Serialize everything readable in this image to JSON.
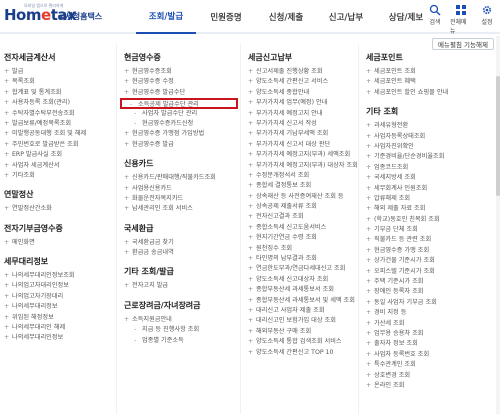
{
  "header": {
    "logo_mark_a": "Hom",
    "logo_mark_x": "e",
    "logo_mark_b": "tax",
    "logo_korean": "국세청홈택스",
    "logo_tiny": "모바일 앱으로 편리하게",
    "tabs": [
      {
        "label": "조회/발급",
        "active": true
      },
      {
        "label": "민원증명",
        "active": false
      },
      {
        "label": "신청/제출",
        "active": false
      },
      {
        "label": "신고/납부",
        "active": false
      },
      {
        "label": "상담/제보",
        "active": false
      }
    ],
    "util": [
      {
        "label": "검색",
        "icon": "search-icon"
      },
      {
        "label": "전체메뉴",
        "icon": "menu-icon"
      },
      {
        "label": "설정",
        "icon": "gear-icon"
      }
    ],
    "menu_button": "메뉴펼침 기능해제"
  },
  "columns": {
    "c1": {
      "sections": [
        {
          "title": "전자세금계산서",
          "items": [
            "발급",
            "목록조회",
            "합계표 및 통계조회",
            "사용자등록 조회(관리)",
            "수탁자별수탁부전송조회",
            "발급보류/예정목록조회",
            "미발행공동대행 조회 및 해제",
            "주민번호로 발급받은 조회",
            "ERP 발급사실 조회",
            "사업자 세금계산서",
            "기타조회"
          ]
        },
        {
          "title": "연말정산",
          "items": [
            "연말정산간소화"
          ]
        },
        {
          "title": "전자기부금영수증",
          "items": [
            "메인화면"
          ]
        },
        {
          "title": "세무대리정보",
          "items": [
            "나의세무대리인정보조회",
            "나의업고자대리인정보",
            "나의업고자기장대리",
            "나의세무대리정보",
            "위임된 해정정보",
            "나의세무대리인 해제",
            "나의세무대리인정보"
          ]
        }
      ]
    },
    "c2": {
      "sections": [
        {
          "title": "현금영수증",
          "items": [
            {
              "t": "현금영수증조회",
              "indent": false
            },
            {
              "t": "현금영수증 수정",
              "indent": false
            },
            {
              "t": "현금영수증 발급수단",
              "indent": false
            },
            {
              "t": "소득공제 발급수단 관리",
              "indent": true,
              "hl": true
            },
            {
              "t": "사업자 발급수단 관리",
              "indent": true
            },
            {
              "t": "현금영수증카드신청",
              "indent": true
            },
            {
              "t": "현금영수증 가맹점 가입방법",
              "indent": false
            },
            {
              "t": "현금영수증 발급",
              "indent": false
            }
          ]
        },
        {
          "title": "신용카드",
          "items": [
            {
              "t": "신용카드/판매대행/직불카드조회",
              "indent": false
            },
            {
              "t": "사업용신용카드",
              "indent": false
            },
            {
              "t": "화물운전자복지카드",
              "indent": false
            },
            {
              "t": "납세관리인 조회 서비스",
              "indent": false
            }
          ]
        },
        {
          "title": "국세환급",
          "items": [
            {
              "t": "국세환급금 찾기",
              "indent": false
            },
            {
              "t": "환급금 송금내역",
              "indent": false
            }
          ]
        },
        {
          "title": "기타 조회/발급",
          "items": [
            {
              "t": "전자고지 발급",
              "indent": false
            }
          ]
        },
        {
          "title": "근로장려금/자녀장려금",
          "items": [
            {
              "t": "소득지원금안내",
              "indent": false
            },
            {
              "t": "지급 등 진행사항 조회",
              "indent": true
            },
            {
              "t": "업종별 기준소득",
              "indent": true
            }
          ]
        }
      ]
    },
    "c3": {
      "sections": [
        {
          "title": "세금신고납부",
          "items": [
            "신고서제출 진행상황 조회",
            "양도소득세 간편신고 서비스",
            "양도소득세 종합안내",
            "부가가치세 업무(예정) 안내",
            "부가가치세 예정고지 안내",
            "부가가치세 신고서 작성",
            "부가가치세 기납부세액 조회",
            "부가가치세 신고서 대상 판단",
            "부가가치세 예정고지(부과) 세액조회",
            "부가가치세 예정고지(부과) 대상자 조회",
            "수정분개정석서 조회",
            "종합세 결정통보 조회",
            "상속재산 등 사전증여재산 조회 등",
            "상속공제 제출서류 조회",
            "전자신고결과 조회",
            "종합소득세 신고도움서비스",
            "현지기간연금 수령 조회",
            "원천징수 조회",
            "타인명의 납부결과 조회",
            "연금한도부과/연금다세대신고 조회",
            "양도소득세 신고대상자 조회",
            "종합부동산세 과세통보서 조회",
            "종합부동산세 과세통보서 및 세액 조회",
            "대리신고 사업자 제출 조회",
            "대리신고인 보험가입 대상 조회",
            "해외부동산 구매 조회",
            "양도소득세 통합 검색조회 서비스",
            "양도소득세 간편신고 TOP 10"
          ]
        }
      ]
    },
    "c4": {
      "sections": [
        {
          "title": "세금포인트",
          "items": [
            "세금포인트 조회",
            "세금포인트 혜택",
            "세금포인트 할인 쇼핑몰 안내"
          ]
        },
        {
          "title": "기타 조회",
          "items": [
            "과세유형전환",
            "사업자등록상태조회",
            "사업자진위확인",
            "기준경비율/단순경비율조회",
            "업종코드조회",
            "국세지방세 조회",
            "세무회계사 인원조회",
            "압류해제 조회",
            "해외 제출 자료 조회",
            "(학교)동호인 친목회 조회",
            "기부금 단체 조회",
            "직불카드 등 관련 조회",
            "현금영수증 가맹 조회",
            "상가건물 기준시가 조회",
            "오피스텔 기준시가 조회",
            "주택 기준시가 조회",
            "장애인 등록자 조회",
            "동일 사업자 기부금 조회",
            "경비 지정 등",
            "가산세 조회",
            "업무용 승용차 조회",
            "출자자 정보 조회",
            "사업자 등록번호 조회",
            "특수관계인 조회",
            "상호변경 조회",
            "온라인 조회"
          ]
        }
      ]
    }
  }
}
